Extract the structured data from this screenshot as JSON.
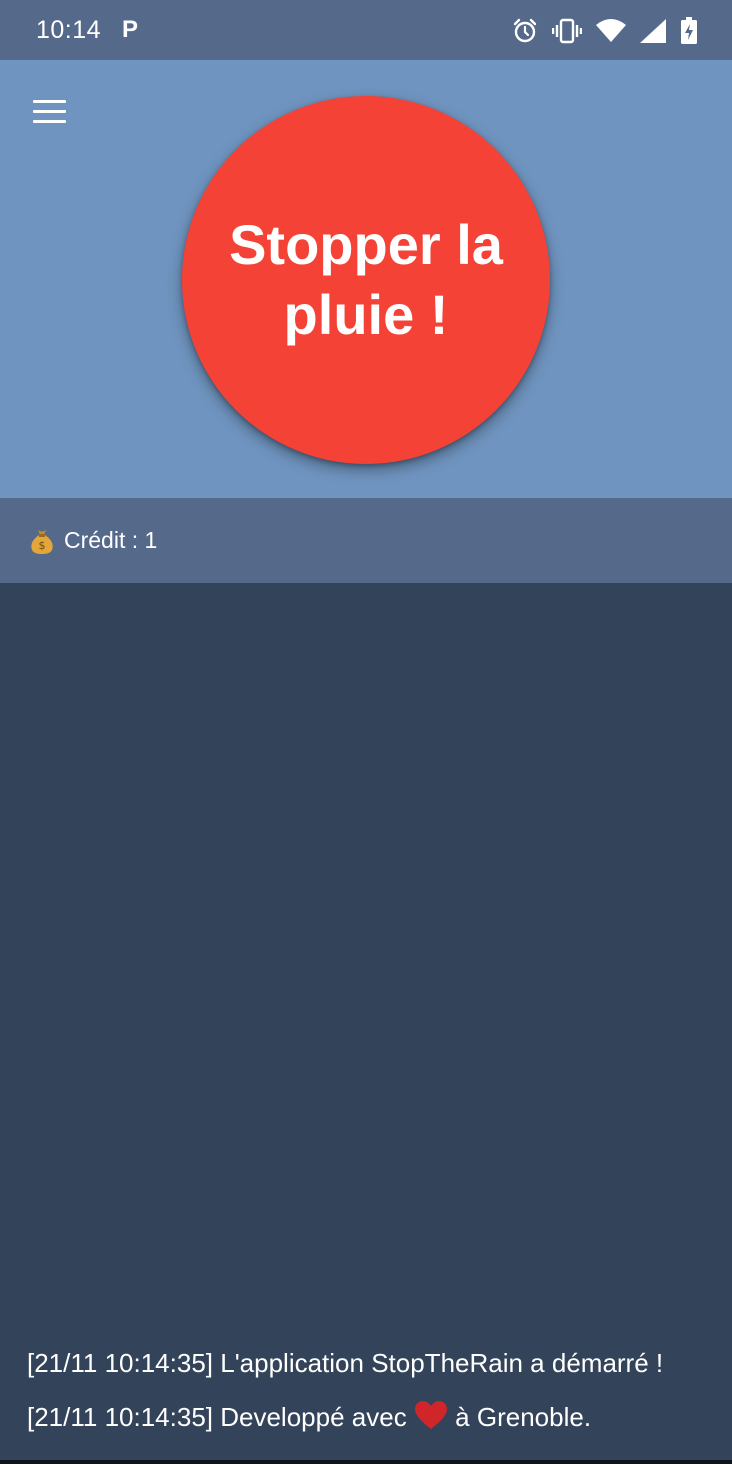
{
  "status_bar": {
    "time": "10:14",
    "app_indicator": "P",
    "icons": [
      "alarm-icon",
      "vibrate-icon",
      "wifi-icon",
      "signal-icon",
      "battery-charging-icon"
    ]
  },
  "hero": {
    "menu_icon": "hamburger-menu-icon",
    "stop_button_label": "Stopper la pluie !",
    "stop_button_color": "#f44336",
    "background_color": "#6f94bf"
  },
  "credit": {
    "icon": "money-bag-icon",
    "label": "Crédit : 1"
  },
  "log": {
    "lines": [
      {
        "text": "[21/11 10:14:35] L'application StopTheRain a démarré !"
      },
      {
        "prefix": "[21/11 10:14:35] Developpé avec",
        "icon": "heart-icon",
        "suffix": "à Grenoble."
      }
    ]
  },
  "colors": {
    "status_bar": "#55698a",
    "credit_bar": "#55698a",
    "main_background": "#334359"
  }
}
